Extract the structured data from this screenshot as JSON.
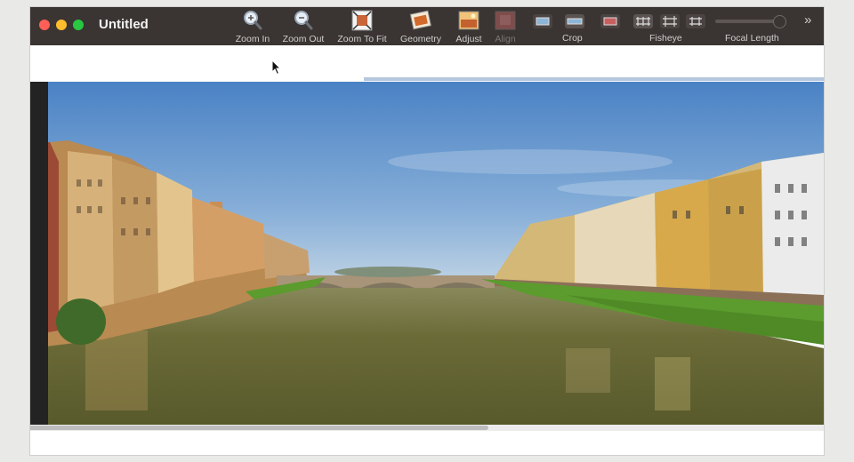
{
  "window": {
    "title": "Untitled"
  },
  "toolbar": {
    "zoom_in": "Zoom In",
    "zoom_out": "Zoom Out",
    "zoom_fit": "Zoom To Fit",
    "geometry": "Geometry",
    "adjust": "Adjust",
    "align": "Align",
    "crop": "Crop",
    "fisheye": "Fisheye",
    "focal_length": "Focal Length",
    "focal_length_value": 0.9
  },
  "colors": {
    "titlebar": "#3a3432",
    "sky": "#5f90c9",
    "river": "#6a6a36",
    "grass": "#5c9b2e"
  },
  "icons": [
    "zoom-in-icon",
    "zoom-out-icon",
    "zoom-fit-icon",
    "geometry-icon",
    "adjust-icon",
    "align-icon",
    "crop-icon",
    "fisheye-icon",
    "chevron-right-icon"
  ]
}
